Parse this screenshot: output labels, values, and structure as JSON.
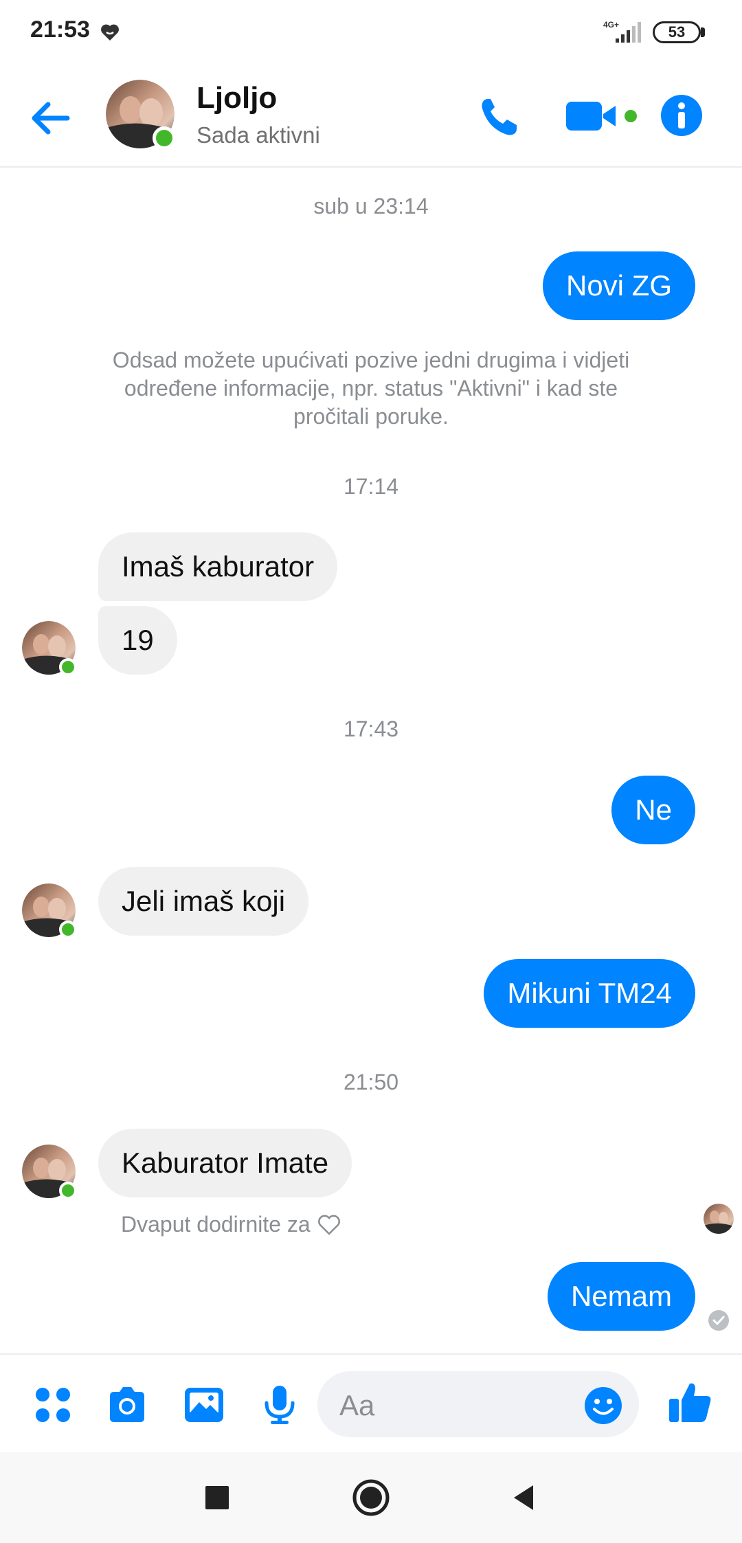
{
  "status_bar": {
    "time": "21:53",
    "network": "4G+",
    "battery": "53",
    "icons": [
      "heart-status-icon",
      "signal-icon",
      "battery-icon"
    ]
  },
  "header": {
    "contact_name": "Ljoljo",
    "contact_status": "Sada aktivni",
    "icons": [
      "back-arrow-icon",
      "phone-icon",
      "video-camera-icon",
      "info-icon"
    ]
  },
  "chat": {
    "timestamps": [
      "sub u 23:14",
      "17:14",
      "17:43",
      "21:50"
    ],
    "system_message": "Odsad možete upućivati pozive jedni drugima i vidjeti određene informacije, npr. status \"Aktivni\" i kad ste pročitali poruke.",
    "messages": [
      {
        "direction": "out",
        "text": "Novi ZG"
      },
      {
        "direction": "in",
        "text": "Imaš kaburator"
      },
      {
        "direction": "in",
        "text": "19"
      },
      {
        "direction": "out",
        "text": "Ne"
      },
      {
        "direction": "in",
        "text": "Jeli imaš koji"
      },
      {
        "direction": "out",
        "text": "Mikuni TM24"
      },
      {
        "direction": "in",
        "text": "Kaburator Imate"
      },
      {
        "direction": "out",
        "text": "Nemam"
      }
    ],
    "reaction_hint": "Dvaput dodirnite za"
  },
  "composer": {
    "placeholder": "Aa",
    "icons": [
      "more-apps-icon",
      "camera-icon",
      "gallery-icon",
      "microphone-icon",
      "emoji-icon",
      "thumbs-up-icon"
    ]
  },
  "colors": {
    "accent": "#0084ff",
    "incoming_bubble": "#f0f0f0",
    "online": "#42b72a",
    "muted_text": "#8a8d91"
  }
}
